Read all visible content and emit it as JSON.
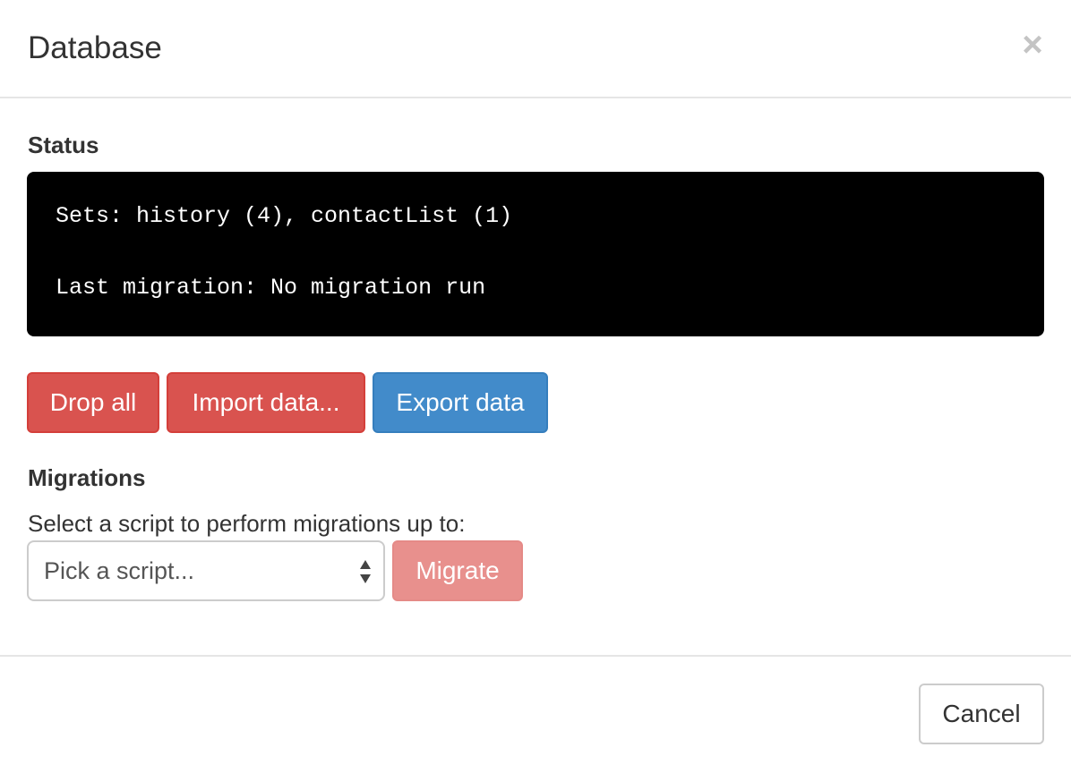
{
  "modal": {
    "title": "Database",
    "close_symbol": "×",
    "close_icon": "close-icon"
  },
  "status": {
    "title": "Status",
    "sets_line": "Sets: history (4), contactList (1)",
    "migration_line": "Last migration: No migration run"
  },
  "actions": {
    "drop_all": "Drop all",
    "import_data": "Import data...",
    "export_data": "Export data"
  },
  "migrations": {
    "title": "Migrations",
    "select_label": "Select a script to perform migrations up to:",
    "select_value": "Pick a script...",
    "select_icon": "select-arrows-icon",
    "migrate_label": "Migrate"
  },
  "footer": {
    "cancel_label": "Cancel"
  },
  "colors": {
    "danger": "#d9534f",
    "danger_disabled": "#e8908d",
    "primary": "#428bca",
    "status_background": "#000000",
    "status_text": "#ffffff"
  }
}
